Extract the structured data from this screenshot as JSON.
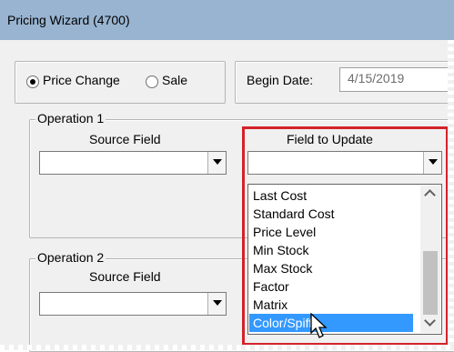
{
  "window": {
    "title": "Pricing Wizard (4700)"
  },
  "options": {
    "price_change_label": "Price Change",
    "price_change_selected": true,
    "sale_label": "Sale",
    "sale_selected": false
  },
  "dates": {
    "begin_label": "Begin Date:",
    "begin_value": "4/15/2019"
  },
  "operation1": {
    "legend": "Operation 1",
    "source_label": "Source Field",
    "source_value": "",
    "field_label": "Field to Update",
    "field_value": ""
  },
  "operation2": {
    "legend": "Operation 2",
    "source_label": "Source Field",
    "source_value": ""
  },
  "dropdown": {
    "items": [
      "Last Cost",
      "Standard Cost",
      "Price Level",
      "Min Stock",
      "Max Stock",
      "Factor",
      "Matrix",
      "Color/Spiff"
    ],
    "selected": "Color/Spiff"
  },
  "colors": {
    "highlight": "#d3222a",
    "selection": "#3399ff",
    "titlebar": "#99b4d1"
  }
}
